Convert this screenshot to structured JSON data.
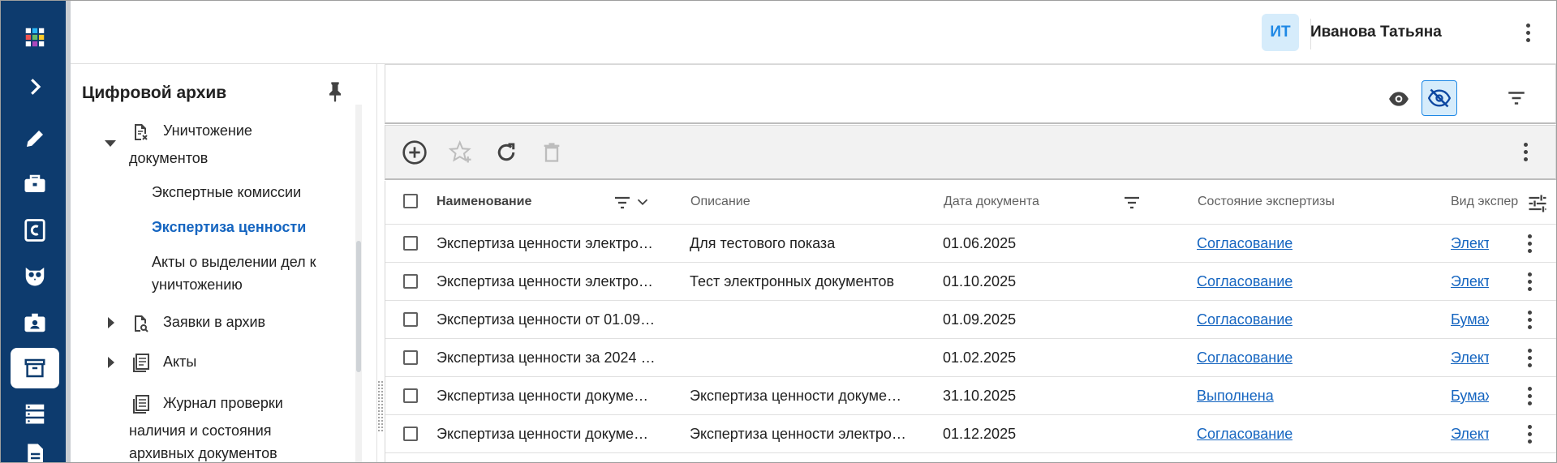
{
  "user": {
    "initials": "ИТ",
    "name": "Иванова Татьяна"
  },
  "tree": {
    "title": "Цифровой архив",
    "nodes": {
      "destruction": "Уничтожение",
      "destruction_2": "документов",
      "expert_commissions": "Экспертные комиссии",
      "value_expertise": "Экспертиза ценности",
      "acts_selection": "Акты о выделении дел к",
      "acts_selection_2": "уничтожению",
      "archive_requests": "Заявки в архив",
      "acts": "Акты",
      "journal_1": "Журнал проверки",
      "journal_2": "наличия и состояния",
      "journal_3": "архивных документов"
    }
  },
  "table": {
    "columns": {
      "name": "Наименование",
      "description": "Описание",
      "doc_date": "Дата документа",
      "expertise_state": "Состояние экспертизы",
      "expertise_type": "Вид экспер"
    },
    "rows": [
      {
        "name": "Экспертиза ценности электро…",
        "description": "Для тестового показа",
        "date": "01.06.2025",
        "state": "Согласование",
        "type": "Элект"
      },
      {
        "name": "Экспертиза ценности электро…",
        "description": "Тест электронных документов",
        "date": "01.10.2025",
        "state": "Согласование",
        "type": "Элект"
      },
      {
        "name": "Экспертиза ценности от 01.09…",
        "description": "",
        "date": "01.09.2025",
        "state": "Согласование",
        "type": "Бумаж"
      },
      {
        "name": "Экспертиза ценности за 2024 …",
        "description": "",
        "date": "01.02.2025",
        "state": "Согласование",
        "type": "Элект"
      },
      {
        "name": "Экспертиза ценности докуме…",
        "description": "Экспертиза ценности докуме…",
        "date": "31.10.2025",
        "state": "Выполнена",
        "type": "Бумаж"
      },
      {
        "name": "Экспертиза ценности докуме…",
        "description": "Экспертиза ценности электро…",
        "date": "01.12.2025",
        "state": "Согласование",
        "type": "Элект"
      }
    ]
  },
  "colors": {
    "rail": "#0d3b6e",
    "link": "#1565c0",
    "accent": "#1e88e5"
  },
  "icons": [
    "apps-icon",
    "chevron-right-icon",
    "pencil-icon",
    "toolbox-icon",
    "c-letter-icon",
    "owl-icon",
    "badge-icon",
    "archive-icon",
    "server-icon",
    "document-icon"
  ]
}
